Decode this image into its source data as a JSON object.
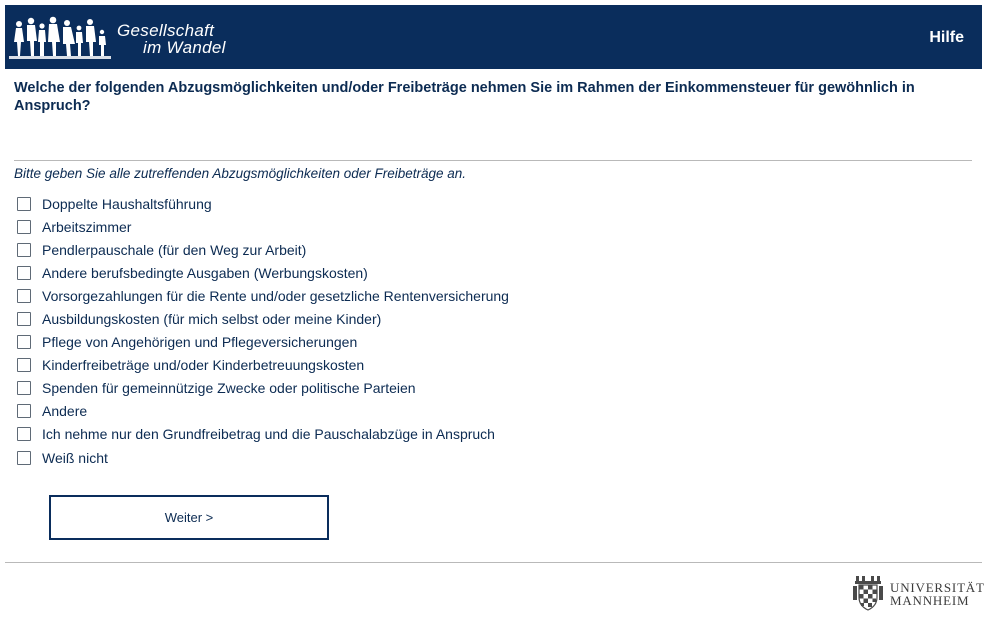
{
  "header": {
    "logo_line1": "Gesellschaft",
    "logo_line2": "im Wandel",
    "help_label": "Hilfe",
    "background_color": "#0a2d5c"
  },
  "question": {
    "text": "Welche der folgenden Abzugsmöglichkeiten und/oder Freibeträge nehmen Sie im Rahmen der Einkommensteuer für gewöhnlich in Anspruch?",
    "instruction": "Bitte geben Sie alle zutreffenden Abzugsmöglichkeiten oder Freibeträge an."
  },
  "options": [
    {
      "label": "Doppelte Haushaltsführung",
      "checked": false
    },
    {
      "label": "Arbeitszimmer",
      "checked": false
    },
    {
      "label": "Pendlerpauschale (für den Weg zur Arbeit)",
      "checked": false
    },
    {
      "label": "Andere berufsbedingte Ausgaben (Werbungskosten)",
      "checked": false
    },
    {
      "label": "Vorsorgezahlungen für die Rente und/oder gesetzliche Rentenversicherung",
      "checked": false
    },
    {
      "label": "Ausbildungskosten (für mich selbst oder meine Kinder)",
      "checked": false
    },
    {
      "label": "Pflege von Angehörigen und Pflegeversicherungen",
      "checked": false
    },
    {
      "label": "Kinderfreibeträge und/oder Kinderbetreuungskosten",
      "checked": false
    },
    {
      "label": "Spenden für gemeinnützige Zwecke oder politische Parteien",
      "checked": false
    },
    {
      "label": "Andere",
      "checked": false
    },
    {
      "label": "Ich nehme nur den Grundfreibetrag und die Pauschalabzüge in Anspruch",
      "checked": false
    },
    {
      "label": "Weiß nicht",
      "checked": false
    }
  ],
  "navigation": {
    "next_label": "Weiter >"
  },
  "footer": {
    "university_line1": "UNIVERSITÄT",
    "university_line2": "MANNHEIM"
  }
}
